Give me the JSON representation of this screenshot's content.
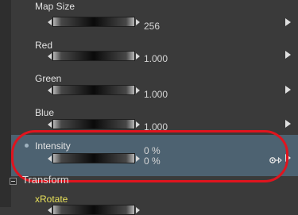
{
  "properties": [
    {
      "label": "Map Size",
      "value": "256"
    },
    {
      "label": "Red",
      "value": "1.000"
    },
    {
      "label": "Green",
      "value": "1.000"
    },
    {
      "label": "Blue",
      "value": "1.000"
    },
    {
      "label": "Intensity",
      "value": "0 %",
      "value2": "0 %"
    }
  ],
  "section": {
    "title": "Transform"
  },
  "next_property": {
    "label": "xRotate"
  },
  "colors": {
    "selected_row": "#4d6271",
    "highlight_ring": "#e0141e",
    "next_label": "#e8e15a"
  }
}
